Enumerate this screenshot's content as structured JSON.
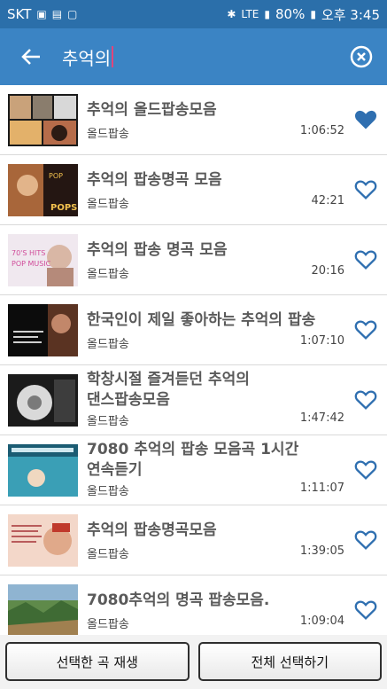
{
  "status_bar": {
    "carrier": "SKT",
    "network": "LTE",
    "battery": "80%",
    "time": "오후 3:45"
  },
  "search": {
    "query": "추억의"
  },
  "items": [
    {
      "title": "추억의 올드팝송모음",
      "category": "올드팝송",
      "duration": "1:06:52",
      "favorite": true
    },
    {
      "title": "추억의 팝송명곡 모음",
      "category": "올드팝송",
      "duration": "42:21",
      "favorite": false
    },
    {
      "title": "추억의 팝송 명곡 모음",
      "category": "올드팝송",
      "duration": "20:16",
      "favorite": false
    },
    {
      "title": "한국인이 제일 좋아하는 추억의 팝송",
      "category": "올드팝송",
      "duration": "1:07:10",
      "favorite": false
    },
    {
      "title_line1": "학창시절 즐겨듣던 추억의",
      "title_line2": "댄스팝송모음",
      "category": "올드팝송",
      "duration": "1:47:42",
      "favorite": false
    },
    {
      "title_line1": "7080 추억의 팝송 모음곡 1시간",
      "title_line2": "연속듣기",
      "category": "올드팝송",
      "duration": "1:11:07",
      "favorite": false
    },
    {
      "title": "추억의 팝송명곡모음",
      "category": "올드팝송",
      "duration": "1:39:05",
      "favorite": false
    },
    {
      "title": "7080추억의  명곡 팝송모음.",
      "category": "올드팝송",
      "duration": "1:09:04",
      "favorite": false
    }
  ],
  "thumbnail_text": {
    "t2_top": "POP",
    "t2_bottom": "POPS",
    "t3_line1": "70'S HITS",
    "t3_line2": "POP MUSIC"
  },
  "buttons": {
    "play_selected": "선택한 곡 재생",
    "select_all": "전체 선택하기"
  },
  "colors": {
    "status_bar": "#2b6faa",
    "app_bar": "#3b84c4",
    "heart": "#2f6fb0"
  }
}
